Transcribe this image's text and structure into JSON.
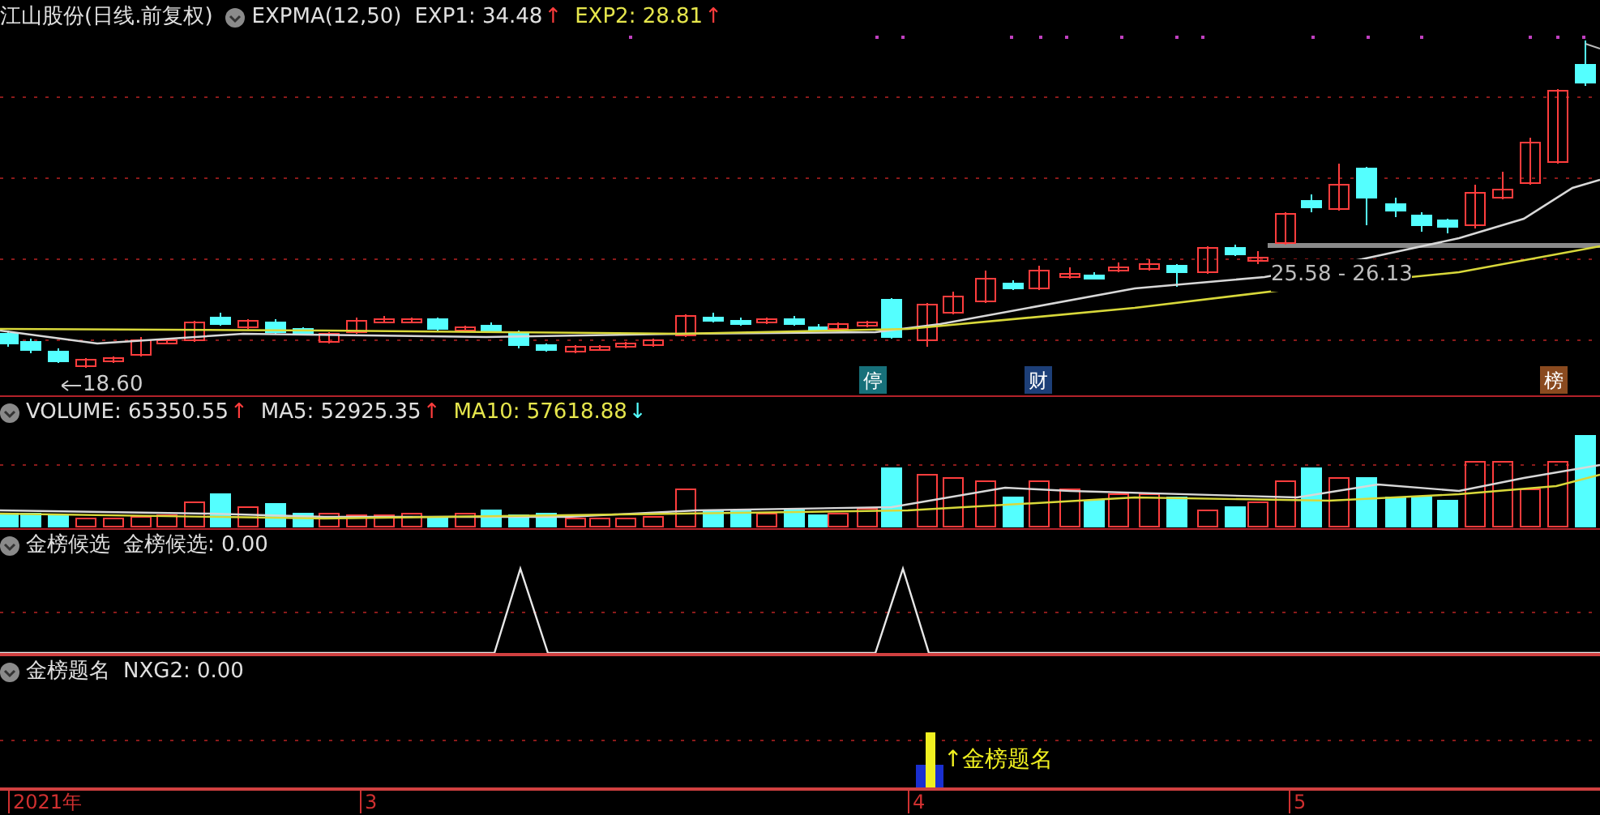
{
  "main_panel": {
    "title": "江山股份(日线.前复权)",
    "indicator": "EXPMA(12,50)",
    "readings": [
      {
        "label": "EXP1: 34.48",
        "arrow": {
          "text": "↑",
          "color": "#ff3d3d"
        },
        "color": "#e0e0e0"
      },
      {
        "label": "EXP2: 28.81",
        "arrow": {
          "text": "↑",
          "color": "#ff3d3d"
        },
        "color": "#e6e64c"
      }
    ],
    "low_label": "18.60",
    "range_label": "25.58 - 26.13",
    "markers": [
      {
        "text": "停",
        "color": "#17707a"
      },
      {
        "text": "财",
        "color": "#1d3f78"
      },
      {
        "text": "榜",
        "color": "#8a4a1f"
      }
    ]
  },
  "volume_panel": {
    "readings": [
      {
        "label": "VOLUME: 65350.55",
        "arrow": {
          "text": "↑",
          "color": "#ff3d3d"
        },
        "color": "#e0e0e0"
      },
      {
        "label": "MA5: 52925.35",
        "arrow": {
          "text": "↑",
          "color": "#ff3d3d"
        },
        "color": "#e0e0e0"
      },
      {
        "label": "MA10: 57618.88",
        "arrow": {
          "text": "↓",
          "color": "#54ffff"
        },
        "color": "#e6e64c"
      }
    ]
  },
  "candidate_panel": {
    "name": "金榜候选",
    "readings": [
      {
        "label": "金榜候选: 0.00",
        "color": "#e0e0e0"
      }
    ]
  },
  "nxg2_panel": {
    "name": "金榜题名",
    "readings": [
      {
        "label": "NXG2: 0.00",
        "color": "#e0e0e0"
      }
    ],
    "signal_label": "↑金榜题名"
  },
  "time_axis": [
    "2021年",
    "3",
    "4",
    "5"
  ]
}
